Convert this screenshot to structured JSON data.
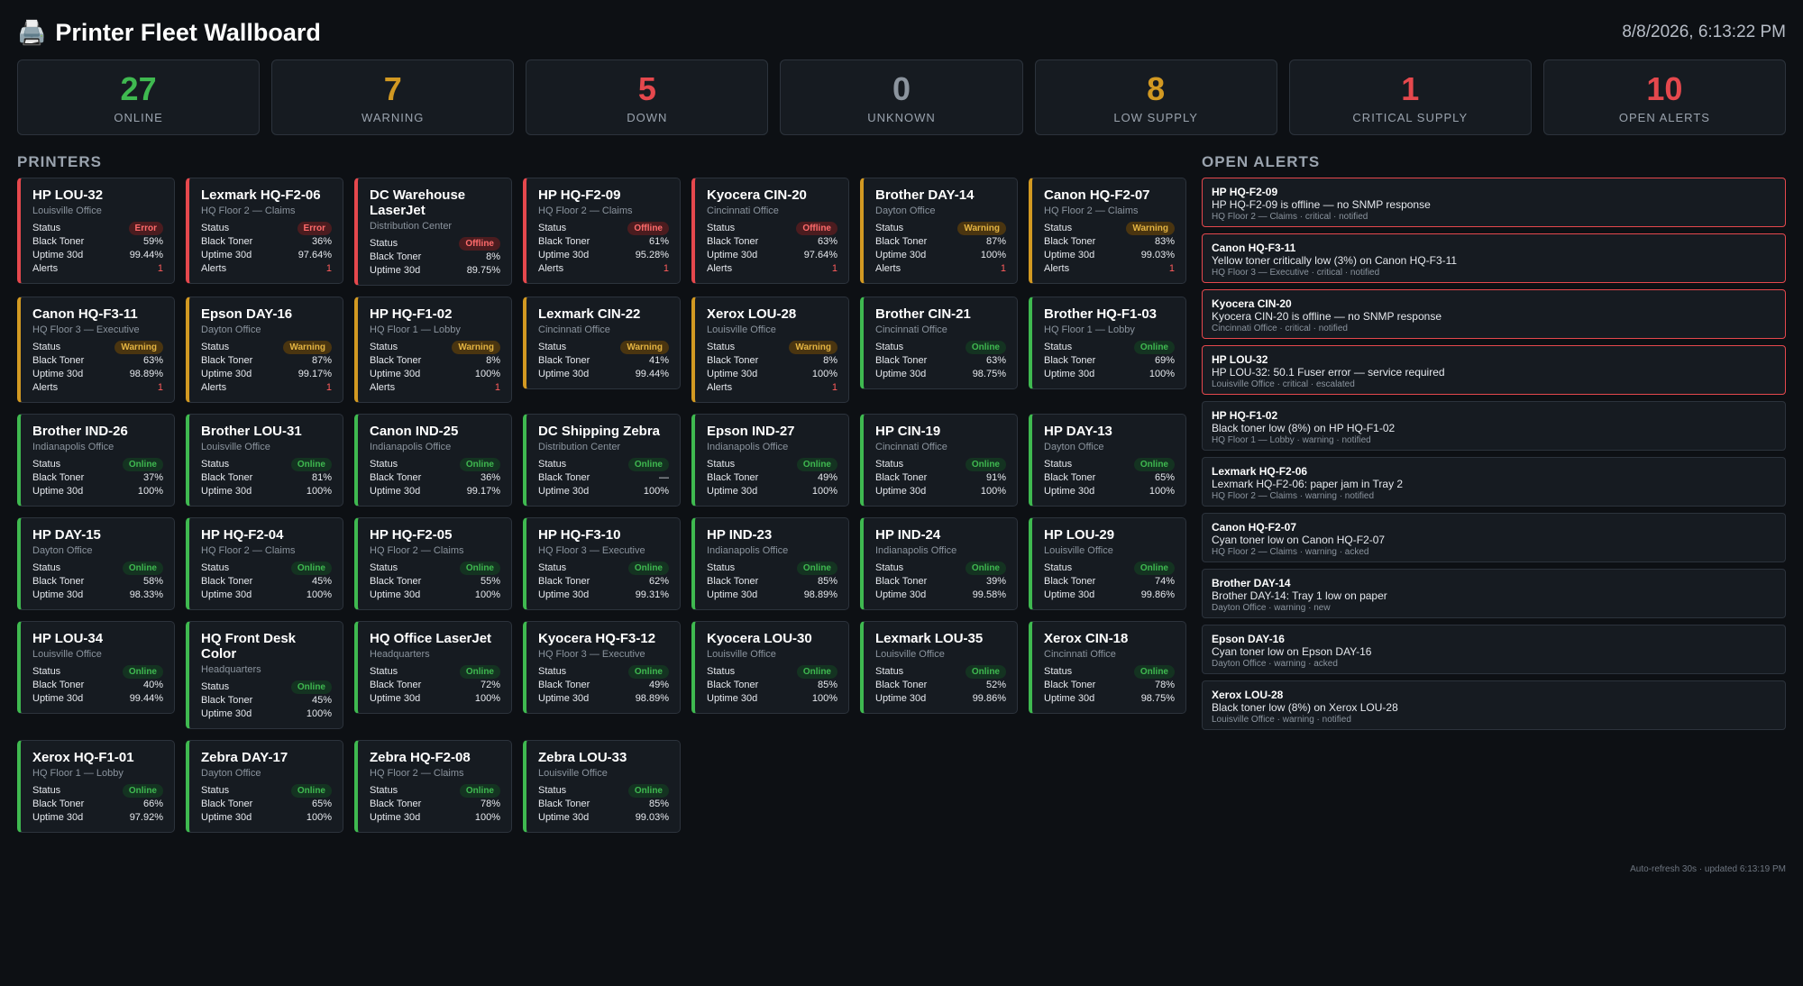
{
  "header": {
    "icon": "printer-icon",
    "title": "Printer Fleet Wallboard",
    "clock": "8/8/2026, 6:13:22 PM"
  },
  "summary": [
    {
      "value": "27",
      "label": "ONLINE",
      "color": "#3fb950"
    },
    {
      "value": "7",
      "label": "WARNING",
      "color": "#d29922"
    },
    {
      "value": "5",
      "label": "DOWN",
      "color": "#e5484d"
    },
    {
      "value": "0",
      "label": "UNKNOWN",
      "color": "#8b949e"
    },
    {
      "value": "8",
      "label": "LOW SUPPLY",
      "color": "#d29922"
    },
    {
      "value": "1",
      "label": "CRITICAL SUPPLY",
      "color": "#e5484d"
    },
    {
      "value": "10",
      "label": "OPEN ALERTS",
      "color": "#e5484d"
    }
  ],
  "labels": {
    "printers_section": "PRINTERS",
    "alerts_section": "OPEN ALERTS",
    "status": "Status",
    "black_toner": "Black Toner",
    "uptime": "Uptime 30d",
    "alerts": "Alerts"
  },
  "status_colors": {
    "error": "#e5484d",
    "offline": "#e5484d",
    "warning": "#d29922",
    "online": "#3fb950"
  },
  "printers": [
    {
      "name": "HP LOU-32",
      "location": "Louisville Office",
      "status": "Error",
      "state": "error",
      "toner": "59%",
      "uptime": "99.44%",
      "alerts": "1"
    },
    {
      "name": "Lexmark HQ-F2-06",
      "location": "HQ Floor 2 — Claims",
      "status": "Error",
      "state": "error",
      "toner": "36%",
      "uptime": "97.64%",
      "alerts": "1"
    },
    {
      "name": "DC Warehouse LaserJet",
      "location": "Distribution Center",
      "status": "Offline",
      "state": "offline",
      "toner": "8%",
      "uptime": "89.75%",
      "alerts": null
    },
    {
      "name": "HP HQ-F2-09",
      "location": "HQ Floor 2 — Claims",
      "status": "Offline",
      "state": "offline",
      "toner": "61%",
      "uptime": "95.28%",
      "alerts": "1"
    },
    {
      "name": "Kyocera CIN-20",
      "location": "Cincinnati Office",
      "status": "Offline",
      "state": "offline",
      "toner": "63%",
      "uptime": "97.64%",
      "alerts": "1"
    },
    {
      "name": "Brother DAY-14",
      "location": "Dayton Office",
      "status": "Warning",
      "state": "warning",
      "toner": "87%",
      "uptime": "100%",
      "alerts": "1"
    },
    {
      "name": "Canon HQ-F2-07",
      "location": "HQ Floor 2 — Claims",
      "status": "Warning",
      "state": "warning",
      "toner": "83%",
      "uptime": "99.03%",
      "alerts": "1"
    },
    {
      "name": "Canon HQ-F3-11",
      "location": "HQ Floor 3 — Executive",
      "status": "Warning",
      "state": "warning",
      "toner": "63%",
      "uptime": "98.89%",
      "alerts": "1"
    },
    {
      "name": "Epson DAY-16",
      "location": "Dayton Office",
      "status": "Warning",
      "state": "warning",
      "toner": "87%",
      "uptime": "99.17%",
      "alerts": "1"
    },
    {
      "name": "HP HQ-F1-02",
      "location": "HQ Floor 1 — Lobby",
      "status": "Warning",
      "state": "warning",
      "toner": "8%",
      "uptime": "100%",
      "alerts": "1"
    },
    {
      "name": "Lexmark CIN-22",
      "location": "Cincinnati Office",
      "status": "Warning",
      "state": "warning",
      "toner": "41%",
      "uptime": "99.44%",
      "alerts": null
    },
    {
      "name": "Xerox LOU-28",
      "location": "Louisville Office",
      "status": "Warning",
      "state": "warning",
      "toner": "8%",
      "uptime": "100%",
      "alerts": "1"
    },
    {
      "name": "Brother CIN-21",
      "location": "Cincinnati Office",
      "status": "Online",
      "state": "online",
      "toner": "63%",
      "uptime": "98.75%",
      "alerts": null
    },
    {
      "name": "Brother HQ-F1-03",
      "location": "HQ Floor 1 — Lobby",
      "status": "Online",
      "state": "online",
      "toner": "69%",
      "uptime": "100%",
      "alerts": null
    },
    {
      "name": "Brother IND-26",
      "location": "Indianapolis Office",
      "status": "Online",
      "state": "online",
      "toner": "37%",
      "uptime": "100%",
      "alerts": null
    },
    {
      "name": "Brother LOU-31",
      "location": "Louisville Office",
      "status": "Online",
      "state": "online",
      "toner": "81%",
      "uptime": "100%",
      "alerts": null
    },
    {
      "name": "Canon IND-25",
      "location": "Indianapolis Office",
      "status": "Online",
      "state": "online",
      "toner": "36%",
      "uptime": "99.17%",
      "alerts": null
    },
    {
      "name": "DC Shipping Zebra",
      "location": "Distribution Center",
      "status": "Online",
      "state": "online",
      "toner": "—",
      "uptime": "100%",
      "alerts": null
    },
    {
      "name": "Epson IND-27",
      "location": "Indianapolis Office",
      "status": "Online",
      "state": "online",
      "toner": "49%",
      "uptime": "100%",
      "alerts": null
    },
    {
      "name": "HP CIN-19",
      "location": "Cincinnati Office",
      "status": "Online",
      "state": "online",
      "toner": "91%",
      "uptime": "100%",
      "alerts": null
    },
    {
      "name": "HP DAY-13",
      "location": "Dayton Office",
      "status": "Online",
      "state": "online",
      "toner": "65%",
      "uptime": "100%",
      "alerts": null
    },
    {
      "name": "HP DAY-15",
      "location": "Dayton Office",
      "status": "Online",
      "state": "online",
      "toner": "58%",
      "uptime": "98.33%",
      "alerts": null
    },
    {
      "name": "HP HQ-F2-04",
      "location": "HQ Floor 2 — Claims",
      "status": "Online",
      "state": "online",
      "toner": "45%",
      "uptime": "100%",
      "alerts": null
    },
    {
      "name": "HP HQ-F2-05",
      "location": "HQ Floor 2 — Claims",
      "status": "Online",
      "state": "online",
      "toner": "55%",
      "uptime": "100%",
      "alerts": null
    },
    {
      "name": "HP HQ-F3-10",
      "location": "HQ Floor 3 — Executive",
      "status": "Online",
      "state": "online",
      "toner": "62%",
      "uptime": "99.31%",
      "alerts": null
    },
    {
      "name": "HP IND-23",
      "location": "Indianapolis Office",
      "status": "Online",
      "state": "online",
      "toner": "85%",
      "uptime": "98.89%",
      "alerts": null
    },
    {
      "name": "HP IND-24",
      "location": "Indianapolis Office",
      "status": "Online",
      "state": "online",
      "toner": "39%",
      "uptime": "99.58%",
      "alerts": null
    },
    {
      "name": "HP LOU-29",
      "location": "Louisville Office",
      "status": "Online",
      "state": "online",
      "toner": "74%",
      "uptime": "99.86%",
      "alerts": null
    },
    {
      "name": "HP LOU-34",
      "location": "Louisville Office",
      "status": "Online",
      "state": "online",
      "toner": "40%",
      "uptime": "99.44%",
      "alerts": null
    },
    {
      "name": "HQ Front Desk Color",
      "location": "Headquarters",
      "status": "Online",
      "state": "online",
      "toner": "45%",
      "uptime": "100%",
      "alerts": null
    },
    {
      "name": "HQ Office LaserJet",
      "location": "Headquarters",
      "status": "Online",
      "state": "online",
      "toner": "72%",
      "uptime": "100%",
      "alerts": null
    },
    {
      "name": "Kyocera HQ-F3-12",
      "location": "HQ Floor 3 — Executive",
      "status": "Online",
      "state": "online",
      "toner": "49%",
      "uptime": "98.89%",
      "alerts": null
    },
    {
      "name": "Kyocera LOU-30",
      "location": "Louisville Office",
      "status": "Online",
      "state": "online",
      "toner": "85%",
      "uptime": "100%",
      "alerts": null
    },
    {
      "name": "Lexmark LOU-35",
      "location": "Louisville Office",
      "status": "Online",
      "state": "online",
      "toner": "52%",
      "uptime": "99.86%",
      "alerts": null
    },
    {
      "name": "Xerox CIN-18",
      "location": "Cincinnati Office",
      "status": "Online",
      "state": "online",
      "toner": "78%",
      "uptime": "98.75%",
      "alerts": null
    },
    {
      "name": "Xerox HQ-F1-01",
      "location": "HQ Floor 1 — Lobby",
      "status": "Online",
      "state": "online",
      "toner": "66%",
      "uptime": "97.92%",
      "alerts": null
    },
    {
      "name": "Zebra DAY-17",
      "location": "Dayton Office",
      "status": "Online",
      "state": "online",
      "toner": "65%",
      "uptime": "100%",
      "alerts": null
    },
    {
      "name": "Zebra HQ-F2-08",
      "location": "HQ Floor 2 — Claims",
      "status": "Online",
      "state": "online",
      "toner": "78%",
      "uptime": "100%",
      "alerts": null
    },
    {
      "name": "Zebra LOU-33",
      "location": "Louisville Office",
      "status": "Online",
      "state": "online",
      "toner": "85%",
      "uptime": "99.03%",
      "alerts": null
    }
  ],
  "alerts": [
    {
      "printer": "HP HQ-F2-09",
      "message": "HP HQ-F2-09 is offline — no SNMP response",
      "meta": "HQ Floor 2 — Claims · critical · notified",
      "severity": "critical"
    },
    {
      "printer": "Canon HQ-F3-11",
      "message": "Yellow toner critically low (3%) on Canon HQ-F3-11",
      "meta": "HQ Floor 3 — Executive · critical · notified",
      "severity": "critical"
    },
    {
      "printer": "Kyocera CIN-20",
      "message": "Kyocera CIN-20 is offline — no SNMP response",
      "meta": "Cincinnati Office · critical · notified",
      "severity": "critical"
    },
    {
      "printer": "HP LOU-32",
      "message": "HP LOU-32: 50.1 Fuser error — service required",
      "meta": "Louisville Office · critical · escalated",
      "severity": "critical"
    },
    {
      "printer": "HP HQ-F1-02",
      "message": "Black toner low (8%) on HP HQ-F1-02",
      "meta": "HQ Floor 1 — Lobby · warning · notified",
      "severity": "warning"
    },
    {
      "printer": "Lexmark HQ-F2-06",
      "message": "Lexmark HQ-F2-06: paper jam in Tray 2",
      "meta": "HQ Floor 2 — Claims · warning · notified",
      "severity": "warning"
    },
    {
      "printer": "Canon HQ-F2-07",
      "message": "Cyan toner low on Canon HQ-F2-07",
      "meta": "HQ Floor 2 — Claims · warning · acked",
      "severity": "warning"
    },
    {
      "printer": "Brother DAY-14",
      "message": "Brother DAY-14: Tray 1 low on paper",
      "meta": "Dayton Office · warning · new",
      "severity": "warning"
    },
    {
      "printer": "Epson DAY-16",
      "message": "Cyan toner low on Epson DAY-16",
      "meta": "Dayton Office · warning · acked",
      "severity": "warning"
    },
    {
      "printer": "Xerox LOU-28",
      "message": "Black toner low (8%) on Xerox LOU-28",
      "meta": "Louisville Office · warning · notified",
      "severity": "warning"
    }
  ],
  "footer": "Auto-refresh 30s · updated 6:13:19 PM"
}
